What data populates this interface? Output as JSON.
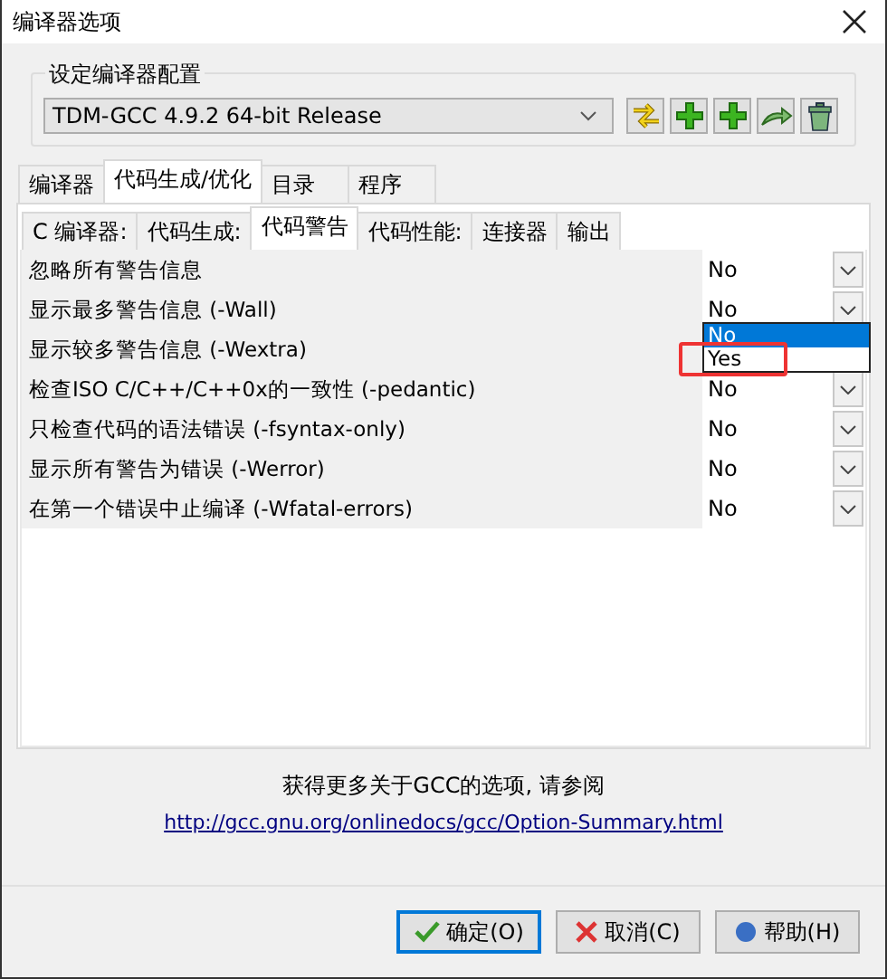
{
  "window": {
    "title": "编译器选项"
  },
  "profile_group": {
    "label": "设定编译器配置",
    "compiler": "TDM-GCC 4.9.2 64-bit Release"
  },
  "tabs": [
    {
      "label": "编译器",
      "selected": false
    },
    {
      "label": "代码生成/优化",
      "selected": true
    },
    {
      "label": "目录",
      "selected": false
    },
    {
      "label": "程序",
      "selected": false
    }
  ],
  "subtabs": [
    {
      "label": "C 编译器:",
      "selected": false
    },
    {
      "label": "代码生成:",
      "selected": false
    },
    {
      "label": "代码警告",
      "selected": true
    },
    {
      "label": "代码性能:",
      "selected": false
    },
    {
      "label": "连接器",
      "selected": false
    },
    {
      "label": "输出",
      "selected": false
    }
  ],
  "options": [
    {
      "label": "忽略所有警告信息",
      "value": "No"
    },
    {
      "label": "显示最多警告信息 (-Wall)",
      "value": "No"
    },
    {
      "label": "显示较多警告信息 (-Wextra)",
      "dropdown": [
        {
          "label": "No",
          "selected": true,
          "highlighted": false
        },
        {
          "label": "Yes",
          "selected": false,
          "highlighted": true
        }
      ]
    },
    {
      "label": "检查ISO C/C++/C++0x的一致性 (-pedantic)",
      "value": "No"
    },
    {
      "label": "只检查代码的语法错误 (-fsyntax-only)",
      "value": "No"
    },
    {
      "label": "显示所有警告为错误 (-Werror)",
      "value": "No"
    },
    {
      "label": "在第一个错误中止编译 (-Wfatal-errors)",
      "value": "No"
    }
  ],
  "footer": {
    "note": "获得更多关于GCC的选项, 请参阅",
    "link": "http://gcc.gnu.org/onlinedocs/gcc/Option-Summary.html"
  },
  "buttons": [
    {
      "label": "确定(O)",
      "kind": "ok"
    },
    {
      "label": "取消(C)",
      "kind": "cancel"
    },
    {
      "label": "帮助(H)",
      "kind": "help"
    }
  ]
}
